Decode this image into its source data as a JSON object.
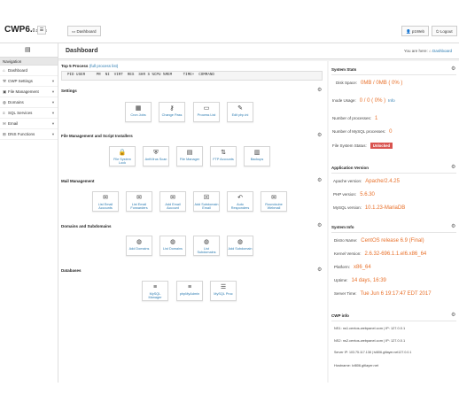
{
  "logo": {
    "main": "CWP6.",
    "sub": "0.x/eas"
  },
  "topbar": {
    "dashboard_btn": "Dashboard",
    "user_btn": "p1Web",
    "logout_btn": "Logout"
  },
  "sidebar": {
    "heading": "Navigation",
    "items": [
      {
        "label": "Dashboard",
        "icon": "home-icon"
      },
      {
        "label": "CWP Settings",
        "icon": "wrench-icon"
      },
      {
        "label": "File Management",
        "icon": "folder-icon"
      },
      {
        "label": "Domains",
        "icon": "globe-icon"
      },
      {
        "label": "SQL Services",
        "icon": "database-icon"
      },
      {
        "label": "Email",
        "icon": "envelope-icon"
      },
      {
        "label": "DNS Functions",
        "icon": "network-icon"
      }
    ]
  },
  "header": {
    "title": "Dashboard",
    "breadcrumb_prefix": "You are here:",
    "breadcrumb": "Dashboard"
  },
  "top_process": {
    "title": "Top 5 Process",
    "link": "(full process list)",
    "columns": "PID USER     PR  NI  VIRT  RES  SHR S %CPU %MEM     TIME+  COMMAND"
  },
  "sections": {
    "settings": {
      "title": "Settings",
      "tiles": [
        "Cron Jobs",
        "Change Pass",
        "Process List",
        "Edit php.ini"
      ]
    },
    "files": {
      "title": "File Management and Script Installers",
      "tiles": [
        "File System Lock",
        "AntiVirus Scan",
        "File Manager",
        "FTP Accounts",
        "Backups"
      ]
    },
    "mail": {
      "title": "Mail Management",
      "tiles": [
        "List Email Accounts",
        "List Email Forwarders",
        "Add Email Account",
        "Add Subdomain Email",
        "Auto Responders",
        "Roundcube Webmail"
      ]
    },
    "domains": {
      "title": "Domains and Subdomains",
      "tiles": [
        "Add Domains",
        "List Domains",
        "List Subdomains",
        "Add Subdomain"
      ]
    },
    "databases": {
      "title": "Databases",
      "tiles": [
        "MySQL Manager",
        "phpMyAdmin",
        "MySQL Proc"
      ]
    }
  },
  "system_stats": {
    "title": "System Stats",
    "disk_label": "Disk Space:",
    "disk_value": "0MB / 0MB ( 0% )",
    "inode_label": "Inode Usage:",
    "inode_value": "0 / 0 ( 0% )",
    "inode_link": "Info",
    "processes_label": "Number of processes:",
    "processes_value": "1",
    "mysql_label": "Number of MySQL processes:",
    "mysql_value": "0",
    "fs_label": "File System Status:",
    "fs_value": "Unlocked"
  },
  "app_version": {
    "title": "Application Version",
    "apache_label": "Apache version:",
    "apache_value": "Apache/2.4.25",
    "php_label": "PHP version:",
    "php_value": "5.6.30",
    "mysql_label": "MySQL version:",
    "mysql_value": "10.1.23-MariaDB"
  },
  "system_info": {
    "title": "System Info",
    "distro_label": "Distro Name:",
    "distro_value": "CentOS release 6.9 (Final)",
    "kernel_label": "Kernel Version:",
    "kernel_value": "2.6.32-696.1.1.el6.x86_64",
    "platform_label": "Platform:",
    "platform_value": "x86_64",
    "uptime_label": "Uptime:",
    "uptime_value": "14 days, 16:39",
    "time_label": "Server Time:",
    "time_value": "Tue Jun 6 19:17:47 EDT 2017"
  },
  "cwp_info": {
    "title": "CWP info",
    "ns1": "NS1: ns1.centos-webpanel.com | IP: 127.0.0.1",
    "ns2": "NS2: ns2.centos-webpanel.com | IP: 127.0.0.1",
    "server_ip": "Server IP: 103.75.117.138 | lvl806.gitlayer.net127.0.0.1",
    "hostname": "Hostname: lvl806.gitlayer.net"
  },
  "colors": {
    "accent": "#e8702a",
    "link": "#2a7ab0",
    "danger": "#d9534f"
  }
}
